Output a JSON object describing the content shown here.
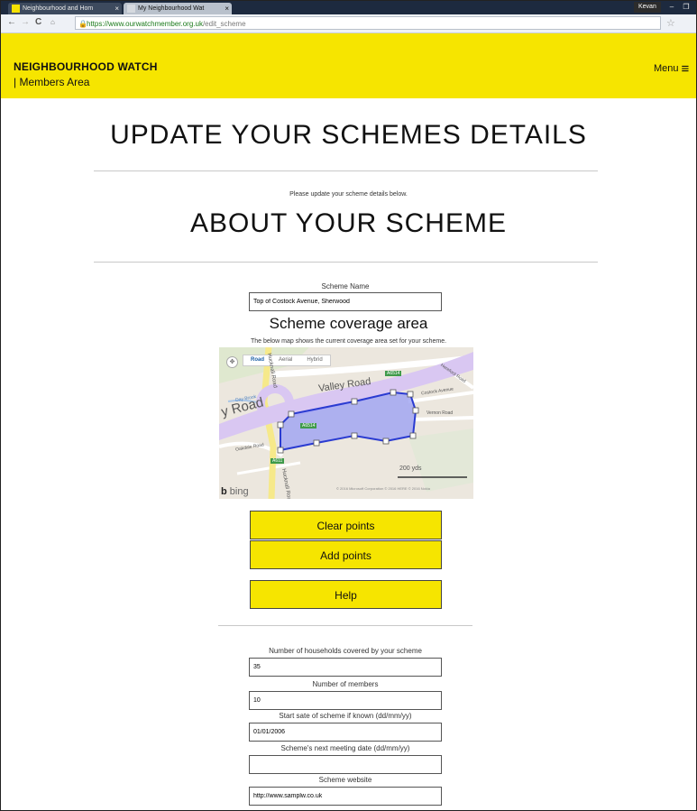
{
  "browser": {
    "tabs": [
      {
        "label": "Neighbourhood and Hom"
      },
      {
        "label": "My Neighbourhood Wat"
      }
    ],
    "user": "Kevan",
    "url": {
      "host": "https://www.ourwatchmember.org.uk",
      "path": "/edit_scheme"
    }
  },
  "header": {
    "brand": "NEIGHBOURHOOD WATCH",
    "subtitle": "| Members Area",
    "menu_label": "Menu"
  },
  "page": {
    "title": "UPDATE YOUR SCHEMES DETAILS",
    "intro": "Please update your scheme details below.",
    "section_title": "ABOUT YOUR SCHEME"
  },
  "scheme_name": {
    "label": "Scheme Name",
    "value": "Top of Costock Avenue, Sherwood"
  },
  "coverage": {
    "title": "Scheme coverage area",
    "description": "The below map shows the current coverage area set for your scheme."
  },
  "map": {
    "types": [
      "Road",
      "Aerial",
      "Hybrid"
    ],
    "active_type": "Road",
    "labels": {
      "valley_road": "Valley Road",
      "valley_road_left": "y Road",
      "costock": "Costock Avenue",
      "day_brook": "Day Brook",
      "a6514_top": "A6514",
      "a6514_mid": "A6514",
      "a611": "A611",
      "hucknall": "Hucknall Road",
      "vernon": "Vernon Road",
      "oakdale": "Oakdale Road",
      "hereford": "Hereford Road"
    },
    "scale": "200 yds",
    "copyright": "© 2016 Microsoft Corporation  © 2016 HERE  © 2016 Nokia",
    "bing": "bing",
    "colors": {
      "polygon_fill": "#9ea3f2",
      "polygon_stroke": "#2a3bd1",
      "valley_road": "#d9c7f2"
    }
  },
  "buttons": {
    "clear": "Clear points",
    "add": "Add points",
    "help": "Help"
  },
  "fields": {
    "households": {
      "label": "Number of households covered by your scheme",
      "value": "35"
    },
    "members": {
      "label": "Number of members",
      "value": "10"
    },
    "start_date": {
      "label": "Start sate of scheme if known (dd/mm/yy)",
      "value": "01/01/2006"
    },
    "meeting_date": {
      "label": "Scheme's next meeting date (dd/mm/yy)",
      "value": ""
    },
    "website": {
      "label": "Scheme website",
      "value": "http://www.samplw.co.uk"
    }
  },
  "colors": {
    "brand_yellow": "#f6e500",
    "tab_bar": "#1d2a3f"
  }
}
